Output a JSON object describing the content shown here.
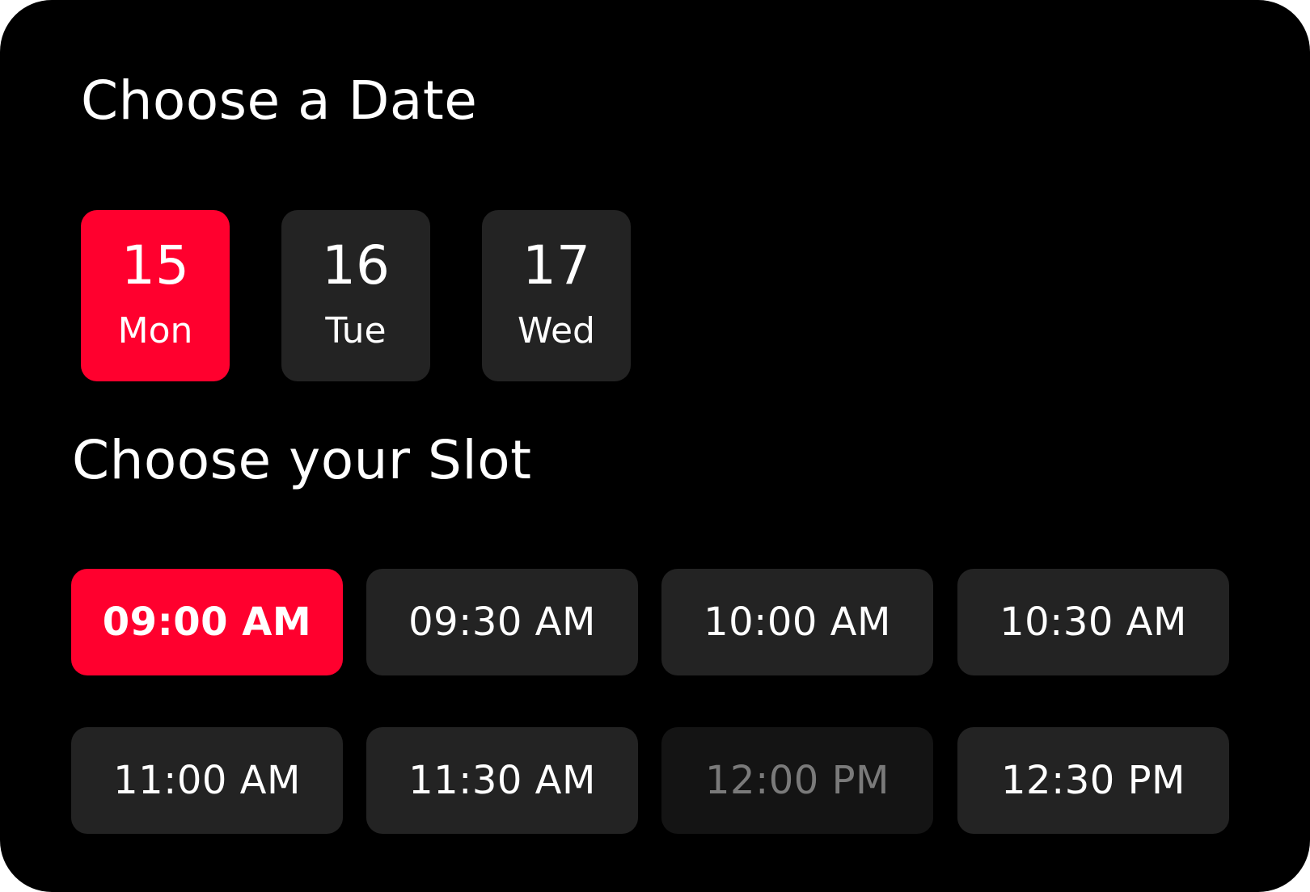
{
  "date_section": {
    "title": "Choose a Date",
    "dates": [
      {
        "number": "15",
        "day": "Mon",
        "selected": true
      },
      {
        "number": "16",
        "day": "Tue",
        "selected": false
      },
      {
        "number": "17",
        "day": "Wed",
        "selected": false
      }
    ]
  },
  "slot_section": {
    "title": "Choose your Slot",
    "slots": [
      {
        "label": "09:00 AM",
        "state": "selected"
      },
      {
        "label": "09:30 AM",
        "state": "available"
      },
      {
        "label": "10:00 AM",
        "state": "available"
      },
      {
        "label": "10:30 AM",
        "state": "available"
      },
      {
        "label": "11:00 AM",
        "state": "available"
      },
      {
        "label": "11:30 AM",
        "state": "available"
      },
      {
        "label": "12:00 PM",
        "state": "disabled"
      },
      {
        "label": "12:30 PM",
        "state": "available"
      }
    ]
  },
  "colors": {
    "background": "#000000",
    "accent": "#ff002e",
    "tile": "#232323",
    "tile_disabled": "#141414",
    "text": "#ffffff",
    "text_disabled": "#7a7a7a"
  }
}
